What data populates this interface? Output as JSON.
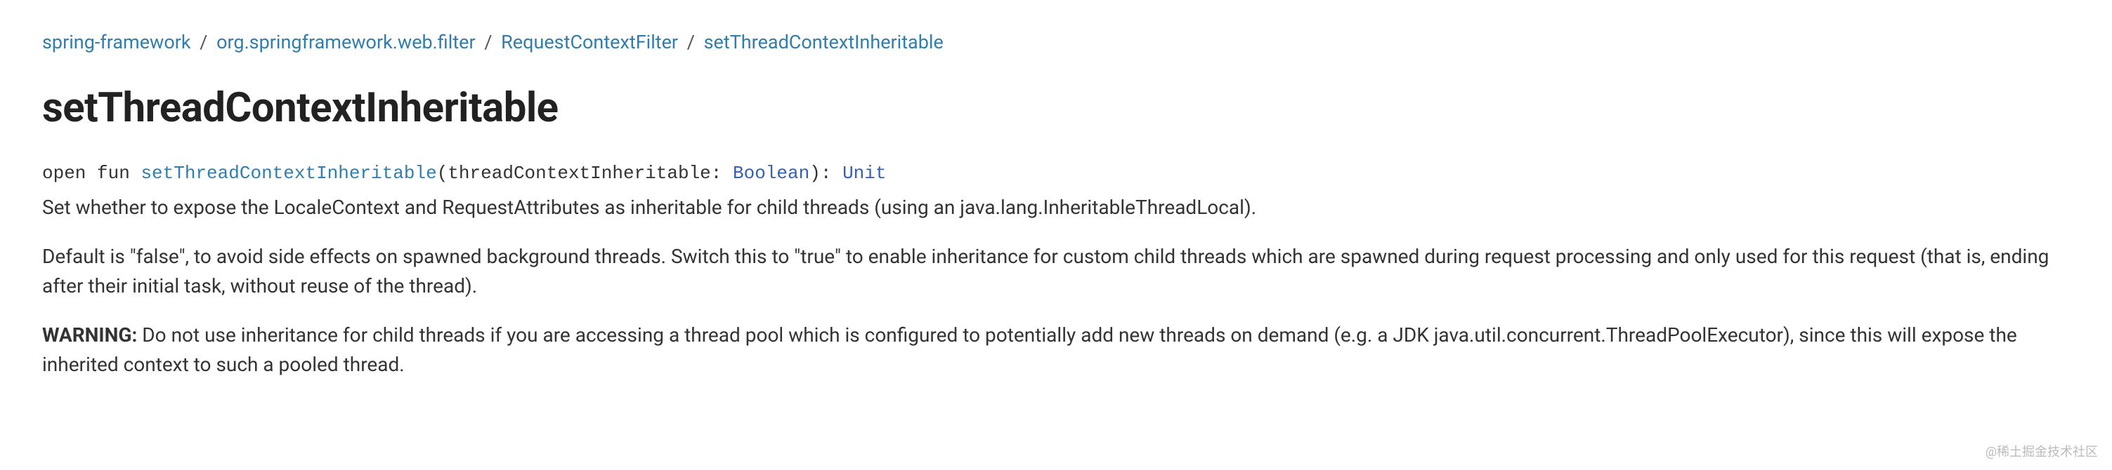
{
  "breadcrumb": {
    "items": [
      {
        "label": "spring-framework"
      },
      {
        "label": "org.springframework.web.filter"
      },
      {
        "label": "RequestContextFilter"
      },
      {
        "label": "setThreadContextInheritable"
      }
    ],
    "separator": "/"
  },
  "title": "setThreadContextInheritable",
  "signature": {
    "modifiers": "open fun ",
    "name": "setThreadContextInheritable",
    "paramOpen": "(",
    "paramName": "threadContextInheritable",
    "paramSep": ": ",
    "paramType": "Boolean",
    "paramClose": ")",
    "returnSep": ": ",
    "returnType": "Unit"
  },
  "paragraphs": {
    "p1": "Set whether to expose the LocaleContext and RequestAttributes as inheritable for child threads (using an java.lang.InheritableThreadLocal).",
    "p2": "Default is \"false\", to avoid side effects on spawned background threads. Switch this to \"true\" to enable inheritance for custom child threads which are spawned during request processing and only used for this request (that is, ending after their initial task, without reuse of the thread).",
    "warningLabel": "WARNING:",
    "p3": " Do not use inheritance for child threads if you are accessing a thread pool which is configured to potentially add new threads on demand (e.g. a JDK java.util.concurrent.ThreadPoolExecutor), since this will expose the inherited context to such a pooled thread."
  },
  "watermark": "@稀土掘金技术社区"
}
